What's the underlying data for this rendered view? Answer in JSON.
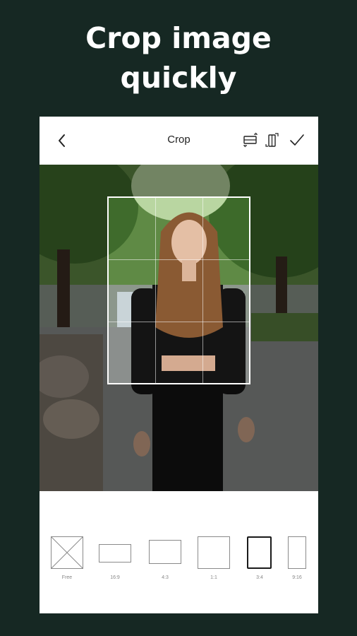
{
  "headline": {
    "line1": "Crop image",
    "line2": "quickly"
  },
  "toolbar": {
    "title": "Crop",
    "back_icon": "chevron-left-icon",
    "flip_horizontal_icon": "flip-horizontal-icon",
    "flip_vertical_icon": "flip-vertical-icon",
    "confirm_icon": "checkmark-icon"
  },
  "ratios": [
    {
      "label": "Free"
    },
    {
      "label": "16:9"
    },
    {
      "label": "4:3"
    },
    {
      "label": "1:1"
    },
    {
      "label": "3:4",
      "selected": true
    },
    {
      "label": "9:16"
    }
  ],
  "colors": {
    "background": "#162823",
    "panel": "#ffffff",
    "selected_border": "#1a1a1a"
  }
}
